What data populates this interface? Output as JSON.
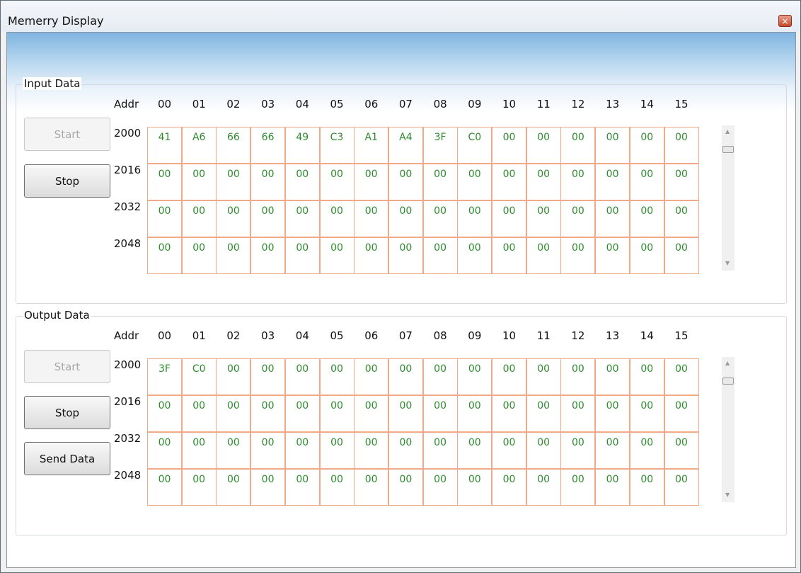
{
  "window": {
    "title": "Memerry Display",
    "close_glyph": "×"
  },
  "columns": [
    "00",
    "01",
    "02",
    "03",
    "04",
    "05",
    "06",
    "07",
    "08",
    "09",
    "10",
    "11",
    "12",
    "13",
    "14",
    "15"
  ],
  "addr_label": "Addr",
  "addresses": [
    "2000",
    "2016",
    "2032",
    "2048"
  ],
  "input": {
    "title": "Input Data",
    "start_label": "Start",
    "stop_label": "Stop",
    "rows": [
      [
        "41",
        "A6",
        "66",
        "66",
        "49",
        "C3",
        "A1",
        "A4",
        "3F",
        "C0",
        "00",
        "00",
        "00",
        "00",
        "00",
        "00"
      ],
      [
        "00",
        "00",
        "00",
        "00",
        "00",
        "00",
        "00",
        "00",
        "00",
        "00",
        "00",
        "00",
        "00",
        "00",
        "00",
        "00"
      ],
      [
        "00",
        "00",
        "00",
        "00",
        "00",
        "00",
        "00",
        "00",
        "00",
        "00",
        "00",
        "00",
        "00",
        "00",
        "00",
        "00"
      ],
      [
        "00",
        "00",
        "00",
        "00",
        "00",
        "00",
        "00",
        "00",
        "00",
        "00",
        "00",
        "00",
        "00",
        "00",
        "00",
        "00"
      ]
    ]
  },
  "output": {
    "title": "Output Data",
    "start_label": "Start",
    "stop_label": "Stop",
    "send_label": "Send Data",
    "rows": [
      [
        "3F",
        "C0",
        "00",
        "00",
        "00",
        "00",
        "00",
        "00",
        "00",
        "00",
        "00",
        "00",
        "00",
        "00",
        "00",
        "00"
      ],
      [
        "00",
        "00",
        "00",
        "00",
        "00",
        "00",
        "00",
        "00",
        "00",
        "00",
        "00",
        "00",
        "00",
        "00",
        "00",
        "00"
      ],
      [
        "00",
        "00",
        "00",
        "00",
        "00",
        "00",
        "00",
        "00",
        "00",
        "00",
        "00",
        "00",
        "00",
        "00",
        "00",
        "00"
      ],
      [
        "00",
        "00",
        "00",
        "00",
        "00",
        "00",
        "00",
        "00",
        "00",
        "00",
        "00",
        "00",
        "00",
        "00",
        "00",
        "00"
      ]
    ]
  },
  "colors": {
    "cell_border": "#f2a987",
    "cell_text": "#2e8b2e",
    "banner": "#7fb4e0"
  },
  "icons": {
    "close": "close-icon",
    "scroll_up": "scroll-up-arrow-icon",
    "scroll_down": "scroll-down-arrow-icon"
  }
}
